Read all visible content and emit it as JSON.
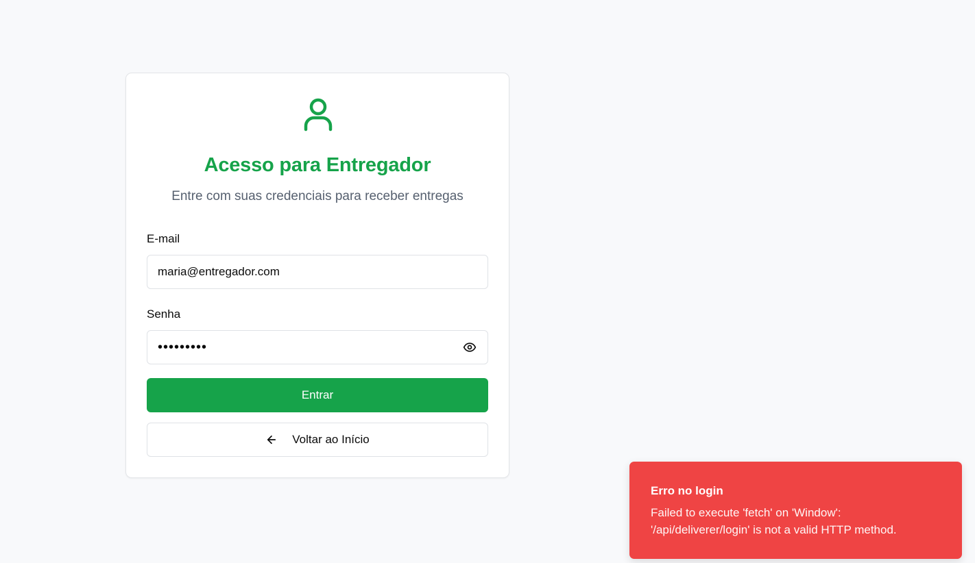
{
  "login_card": {
    "title": "Acesso para Entregador",
    "subtitle": "Entre com suas credenciais para receber entregas",
    "header_icon": "user-icon",
    "email": {
      "label": "E-mail",
      "value": "maria@entregador.com"
    },
    "password": {
      "label": "Senha",
      "value": "•••••••••",
      "toggle_icon": "eye-icon"
    },
    "submit_label": "Entrar",
    "back": {
      "label": "Voltar ao Início",
      "icon": "arrow-left-icon"
    }
  },
  "toast": {
    "title": "Erro no login",
    "message_line1": "Failed to execute 'fetch' on 'Window':",
    "message_line2": "'/api/deliverer/login' is not a valid HTTP method."
  },
  "colors": {
    "brand_green": "#16a34a",
    "error_red": "#ef4444",
    "background": "#f8f9fb"
  }
}
